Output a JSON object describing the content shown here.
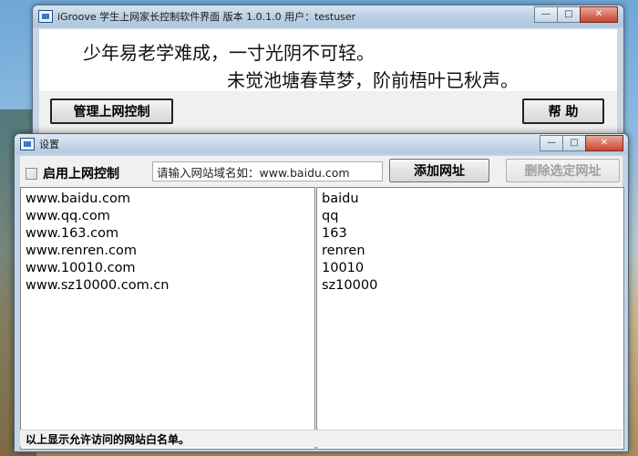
{
  "main_window": {
    "title": "iGroove 学生上网家长控制软件界面 版本 1.0.1.0 用户：testuser",
    "poem_line1": "少年易老学难成，一寸光阴不可轻。",
    "poem_line2": "未觉池塘春草梦，阶前梧叶已秋声。",
    "manage_button": "管理上网控制",
    "help_button": "帮  助",
    "controls": {
      "minimize": "—",
      "maximize": "□",
      "close": "✕"
    }
  },
  "settings_window": {
    "title": "设置",
    "enable_label": "启用上网控制",
    "enable_checked": false,
    "url_input_value": "请输入网站域名如：www.baidu.com",
    "add_button": "添加网址",
    "delete_button": "删除选定网址",
    "domains": [
      "www.baidu.com",
      "www.qq.com",
      "www.163.com",
      "www.renren.com",
      "www.10010.com",
      "www.sz10000.com.cn"
    ],
    "names": [
      "baidu",
      "qq",
      "163",
      "renren",
      "10010",
      "sz10000"
    ],
    "status_text": "以上显示允许访问的网站白名单。",
    "controls": {
      "minimize": "—",
      "maximize": "□",
      "close": "✕"
    }
  },
  "icons": {
    "app": "app-window-icon"
  },
  "colors": {
    "titlebar": "#bcd0e4",
    "close_button": "#c8462d",
    "list_background": "#ffffff"
  }
}
